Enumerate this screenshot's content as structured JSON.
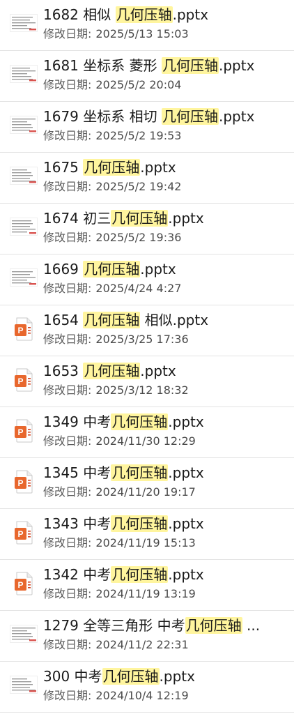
{
  "date_label": "修改日期:",
  "files": [
    {
      "number": "1682",
      "prefix": "相似 ",
      "keyword": "几何压轴",
      "suffix": ".pptx",
      "date": "2025/5/13 15:03",
      "icon": "thumbnail-icon"
    },
    {
      "number": "1681",
      "prefix": "坐标系 菱形 ",
      "keyword": "几何压轴",
      "suffix": ".pptx",
      "date": "2025/5/2 20:04",
      "icon": "thumbnail-icon"
    },
    {
      "number": "1679",
      "prefix": "坐标系 相切 ",
      "keyword": "几何压轴",
      "suffix": ".pptx",
      "date": "2025/5/2 19:53",
      "icon": "thumbnail-icon"
    },
    {
      "number": "1675",
      "prefix": "",
      "keyword": "几何压轴",
      "suffix": ".pptx",
      "date": "2025/5/2 19:42",
      "icon": "thumbnail-icon"
    },
    {
      "number": "1674",
      "prefix": "初三",
      "keyword": "几何压轴",
      "suffix": ".pptx",
      "date": "2025/5/2 19:36",
      "icon": "thumbnail-icon"
    },
    {
      "number": "1669",
      "prefix": "",
      "keyword": "几何压轴",
      "suffix": ".pptx",
      "date": "2025/4/24 4:27",
      "icon": "thumbnail-icon"
    },
    {
      "number": "1654",
      "prefix": "",
      "keyword": "几何压轴",
      "suffix": " 相似.pptx",
      "date": "2025/3/25 17:36",
      "icon": "powerpoint-icon"
    },
    {
      "number": "1653",
      "prefix": "",
      "keyword": "几何压轴",
      "suffix": ".pptx",
      "date": "2025/3/12 18:32",
      "icon": "powerpoint-icon"
    },
    {
      "number": "1349",
      "prefix": "中考",
      "keyword": "几何压轴",
      "suffix": ".pptx",
      "date": "2024/11/30 12:29",
      "icon": "powerpoint-icon"
    },
    {
      "number": "1345",
      "prefix": "中考",
      "keyword": "几何压轴",
      "suffix": ".pptx",
      "date": "2024/11/20 19:17",
      "icon": "powerpoint-icon"
    },
    {
      "number": "1343",
      "prefix": "中考",
      "keyword": "几何压轴",
      "suffix": ".pptx",
      "date": "2024/11/19 15:13",
      "icon": "powerpoint-icon"
    },
    {
      "number": "1342",
      "prefix": "中考",
      "keyword": "几何压轴",
      "suffix": ".pptx",
      "date": "2024/11/19 13:19",
      "icon": "powerpoint-icon"
    },
    {
      "number": "1279",
      "prefix": "全等三角形 中考",
      "keyword": "几何压轴",
      "suffix": " ...",
      "date": "2024/11/2 22:31",
      "icon": "thumbnail-icon"
    },
    {
      "number": "300",
      "prefix": "中考",
      "keyword": "几何压轴",
      "suffix": ".pptx",
      "date": "2024/10/4 12:19",
      "icon": "thumbnail-icon"
    }
  ],
  "colors": {
    "highlight": "#fff59e",
    "ppt_orange": "#e8672d",
    "ppt_red": "#c43e1c",
    "divider": "#e3e3e3"
  }
}
